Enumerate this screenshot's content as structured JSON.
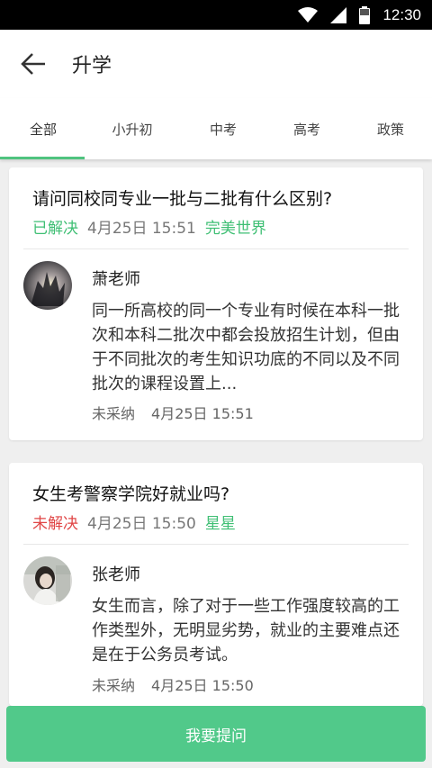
{
  "status_bar": {
    "time": "12:30"
  },
  "header": {
    "title": "升学"
  },
  "tabs": [
    {
      "label": "全部"
    },
    {
      "label": "小升初"
    },
    {
      "label": "中考"
    },
    {
      "label": "高考"
    },
    {
      "label": "政策"
    }
  ],
  "questions": [
    {
      "title": "请问同校同专业一批与二批有什么区别?",
      "status": "已解决",
      "date": "4月25日 15:51",
      "author": "完美世界",
      "answer": {
        "teacher": "萧老师",
        "text": "同一所高校的同一个专业有时候在本科一批次和本科二批次中都会投放招生计划，但由于不同批次的考生知识功底的不同以及不同批次的课程设置上...",
        "adopt_status": "未采纳",
        "date": "4月25日 15:51"
      }
    },
    {
      "title": "女生考警察学院好就业吗?",
      "status": "未解决",
      "date": "4月25日 15:50",
      "author": "星星",
      "answer": {
        "teacher": "张老师",
        "text": "女生而言，除了对于一些工作强度较高的工作类型外，无明显劣势，就业的主要难点还是在于公务员考试。",
        "adopt_status": "未采纳",
        "date": "4月25日 15:50"
      }
    }
  ],
  "actions": {
    "ask_label": "我要提问"
  },
  "colors": {
    "accent": "#4fc37f",
    "unsolved": "#e04646",
    "button": "#51c98a"
  }
}
